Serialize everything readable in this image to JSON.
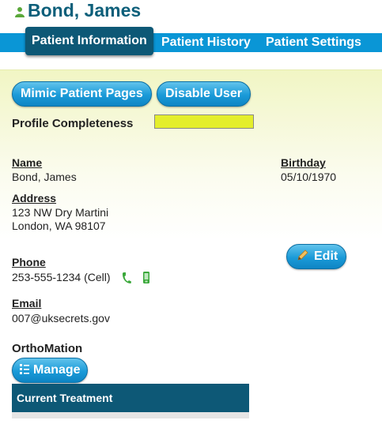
{
  "header": {
    "title": "Bond, James",
    "icon": "user-icon"
  },
  "tabs": [
    {
      "label": "Patient Information",
      "active": true
    },
    {
      "label": "Patient History",
      "active": false
    },
    {
      "label": "Patient Settings",
      "active": false
    }
  ],
  "actions": {
    "mimic_label": "Mimic Patient Pages",
    "disable_label": "Disable User"
  },
  "profile": {
    "label": "Profile Completeness",
    "completeness": 1.0,
    "bar_color": "#e4ee2c"
  },
  "fields": {
    "name_label": "Name",
    "name_value": "Bond, James",
    "birthday_label": "Birthday",
    "birthday_value": "05/10/1970",
    "address_label": "Address",
    "address_line1": "123 NW Dry Martini",
    "address_line2": "London, WA 98107",
    "phone_label": "Phone",
    "phone_value": "253-555-1234 (Cell)",
    "email_label": "Email",
    "email_value": "007@uksecrets.gov"
  },
  "edit_label": "Edit",
  "orthomation": {
    "title": "OrthoMation",
    "manage_label": "Manage",
    "treatment_header": "Current Treatment"
  },
  "colors": {
    "title": "#0d5f7a",
    "tabbar": "#0a96d6",
    "active_tab": "#0d5876",
    "icon_green": "#3aa83a"
  }
}
